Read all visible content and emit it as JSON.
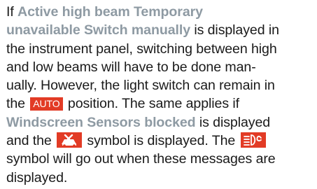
{
  "paragraph": {
    "l1_a": "If ",
    "l1_b": "Active high beam Temporary",
    "l2_a": "unavailable Switch manually",
    "l2_b": " is displayed in",
    "l3": "the instrument panel, switching between high",
    "l4": "and low beams will have to be done man-",
    "l5": "ually. However, the light switch can remain in",
    "l6_a": "the ",
    "l6_badge": "AUTO",
    "l6_b": " position. The same applies if",
    "l7_a": "Windscreen Sensors blocked",
    "l7_b": " is displayed",
    "l8_a": "and the ",
    "l8_b": " symbol is displayed. The ",
    "l9": "symbol will go out when these messages are",
    "l10": "displayed."
  },
  "colors": {
    "highlight": "#8e9aa3",
    "badge": "#e23b25",
    "text": "#1a1a1a"
  },
  "icons": [
    "sensor-blocked-icon",
    "auto-high-beam-icon"
  ]
}
